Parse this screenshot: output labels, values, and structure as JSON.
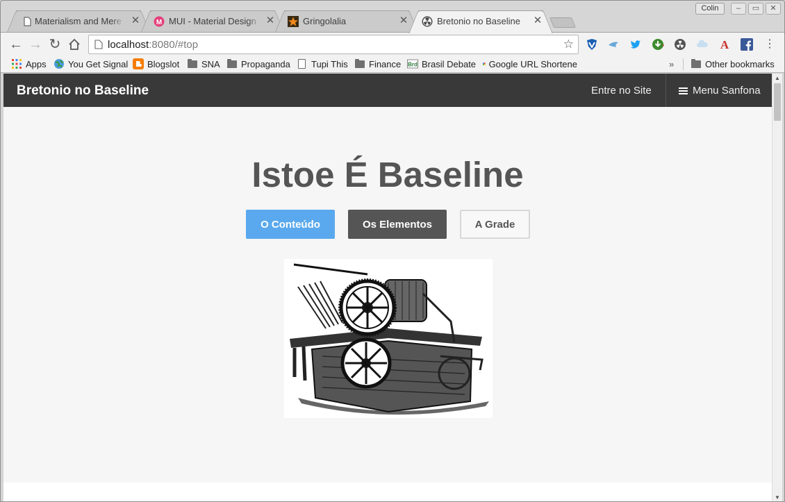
{
  "browser": {
    "tabs": [
      {
        "title": "Materialism and Mere S",
        "active": false
      },
      {
        "title": "MUI - Material Design C",
        "active": false
      },
      {
        "title": "Gringolalia",
        "active": false
      },
      {
        "title": "Bretonio no Baseline",
        "active": true
      }
    ],
    "profile_name": "Colin",
    "url_host": "localhost",
    "url_rest": ":8080/#top",
    "bookmarks": [
      {
        "label": "Apps",
        "icon": "apps-grid-icon"
      },
      {
        "label": "You Get Signal",
        "icon": "globe-icon"
      },
      {
        "label": "Blogslot",
        "icon": "blogger-icon"
      },
      {
        "label": "SNA",
        "icon": "folder-icon"
      },
      {
        "label": "Propaganda",
        "icon": "folder-icon"
      },
      {
        "label": "Tupi This",
        "icon": "page-icon"
      },
      {
        "label": "Finance",
        "icon": "folder-icon"
      },
      {
        "label": "Brasil Debate",
        "icon": "brd-icon"
      },
      {
        "label": "Google URL Shortene",
        "icon": "google-icon"
      }
    ],
    "other_bookmarks": "Other bookmarks",
    "overflow": "»"
  },
  "site": {
    "brand": "Bretonio no Baseline",
    "nav_link": "Entre no Site",
    "menu_label": "Menu Sanfona",
    "hero_title": "Istoe É Baseline",
    "buttons": {
      "primary": "O Conteúdo",
      "secondary": "Os Elementos",
      "ghost": "A Grade"
    },
    "colors": {
      "navbar": "#393939",
      "primary": "#5aa9ee",
      "secondary": "#555555"
    }
  }
}
